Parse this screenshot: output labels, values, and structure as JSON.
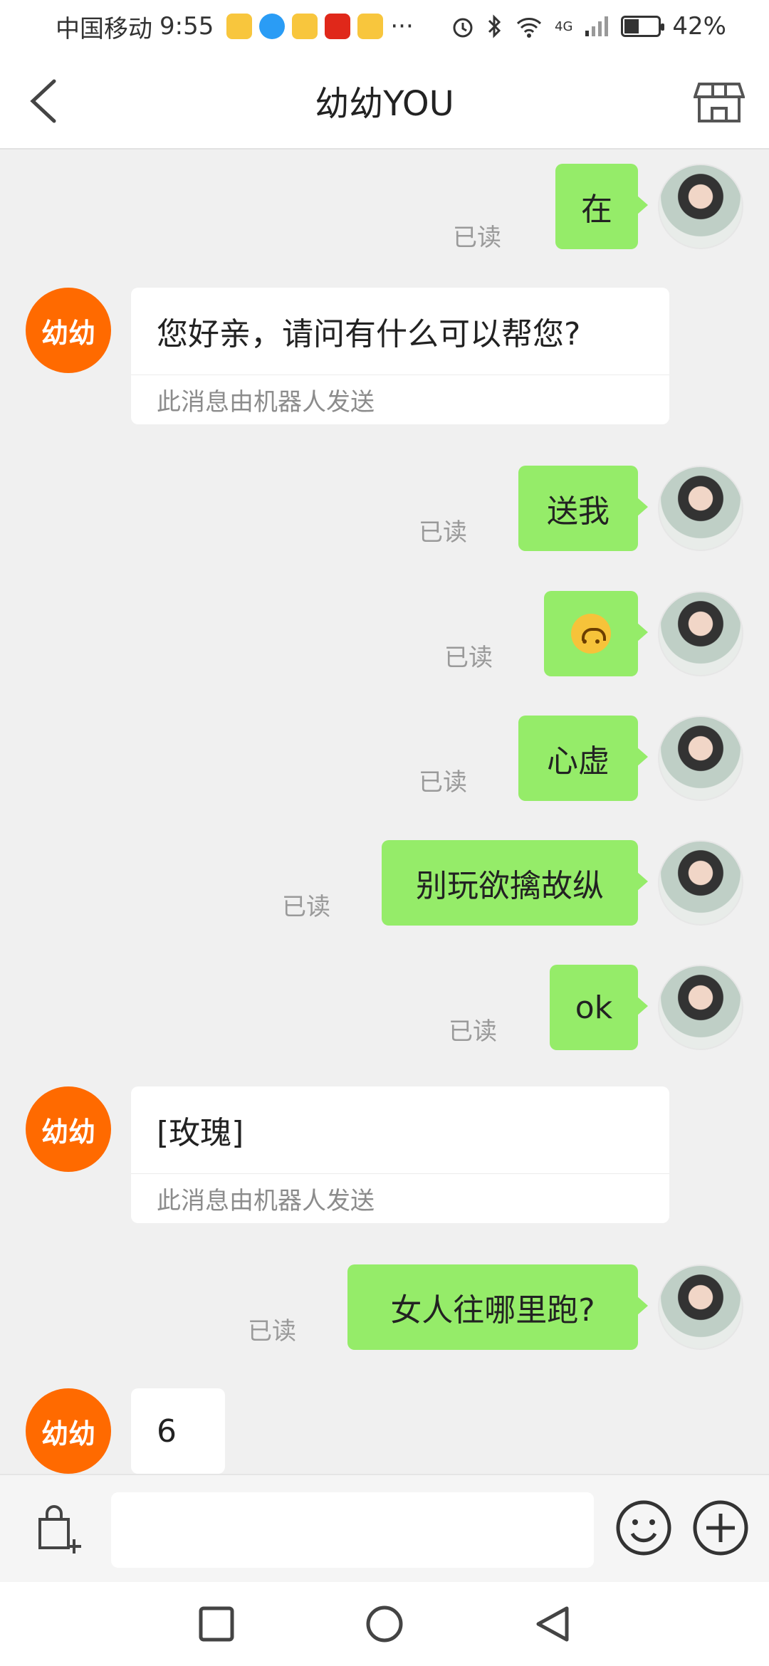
{
  "status_bar": {
    "carrier": "中国移动",
    "time": "9:55",
    "more": "···",
    "network": "4G",
    "battery_pct": 42,
    "battery": "42%"
  },
  "header": {
    "title": "幼幼YOU"
  },
  "messages": [
    {
      "side": "me",
      "text": "在",
      "read": "已读"
    },
    {
      "side": "shop",
      "avatar": "幼幼",
      "text": "您好亲，请问有什么可以帮您?",
      "note": "此消息由机器人发送"
    },
    {
      "side": "me",
      "text": "送我",
      "read": "已读"
    },
    {
      "side": "me",
      "emoji": "upside-down-face-icon",
      "read": "已读"
    },
    {
      "side": "me",
      "text": "心虚",
      "read": "已读"
    },
    {
      "side": "me",
      "text": "别玩欲擒故纵",
      "read": "已读"
    },
    {
      "side": "me",
      "text": "ok",
      "read": "已读"
    },
    {
      "side": "shop",
      "avatar": "幼幼",
      "text": "[玫瑰]",
      "note": "此消息由机器人发送"
    },
    {
      "side": "me",
      "text": "女人往哪里跑?",
      "read": "已读"
    },
    {
      "side": "shop",
      "avatar": "幼幼",
      "text": "6"
    }
  ],
  "colors": {
    "my_bubble": "#95ec69",
    "shop_avatar": "#ff6a00"
  },
  "input": {
    "placeholder": ""
  }
}
